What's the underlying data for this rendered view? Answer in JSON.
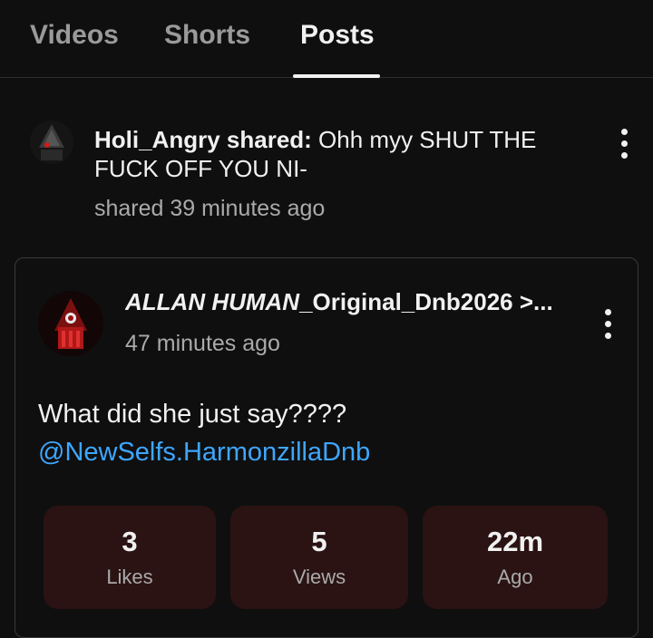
{
  "tabs": [
    {
      "label": "Videos"
    },
    {
      "label": "Shorts"
    },
    {
      "label": "Posts"
    }
  ],
  "share": {
    "user": "Holi_Angry shared:",
    "text": " Ohh myy SHUT THE FUCK OFF YOU NI-",
    "time": "shared 39 minutes ago"
  },
  "post": {
    "author_italic": "ALLAN HUMAN",
    "author_rest": "_Original_Dnb2026 >...",
    "time": "47 minutes ago",
    "body": "What did she just say????",
    "mention": "@NewSelfs.HarmonzillaDnb"
  },
  "stats": [
    {
      "value": "3",
      "label": "Likes"
    },
    {
      "value": "5",
      "label": "Views"
    },
    {
      "value": "22m",
      "label": "Ago"
    }
  ],
  "colors": {
    "background": "#0f0f0f",
    "mention": "#3ea6ff",
    "stat_card": "#2b1313",
    "secondary_text": "#aaaaaa"
  }
}
